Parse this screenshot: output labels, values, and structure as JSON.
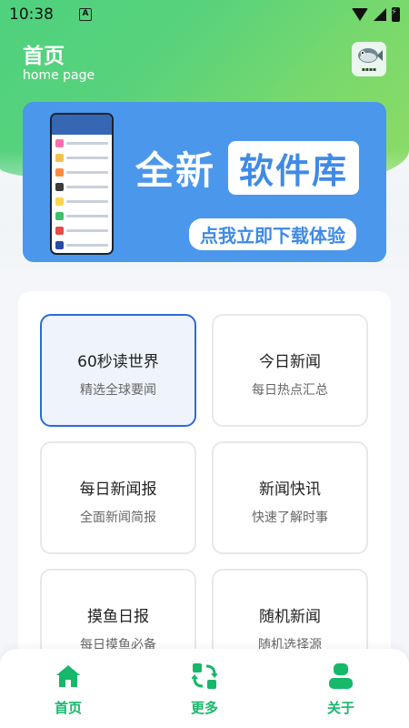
{
  "status_bar": {
    "time": "10:38",
    "a_glyph": "A"
  },
  "header": {
    "title": "首页",
    "subtitle": "home page"
  },
  "banner": {
    "headline_new": "全新",
    "headline_library": "软件库",
    "cta": "点我立即下载体验"
  },
  "tiles": [
    {
      "title": "60秒读世界",
      "desc": "精选全球要闻"
    },
    {
      "title": "今日新闻",
      "desc": "每日热点汇总"
    },
    {
      "title": "每日新闻报",
      "desc": "全面新闻简报"
    },
    {
      "title": "新闻快讯",
      "desc": "快速了解时事"
    },
    {
      "title": "摸鱼日报",
      "desc": "每日摸鱼必备"
    },
    {
      "title": "随机新闻",
      "desc": "随机选择源"
    }
  ],
  "nav": {
    "home": "首页",
    "more": "更多",
    "about": "关于"
  },
  "colors": {
    "accent_green": "#16b86a",
    "active_border": "#2b6bd8",
    "banner_blue": "#4a97ec"
  }
}
